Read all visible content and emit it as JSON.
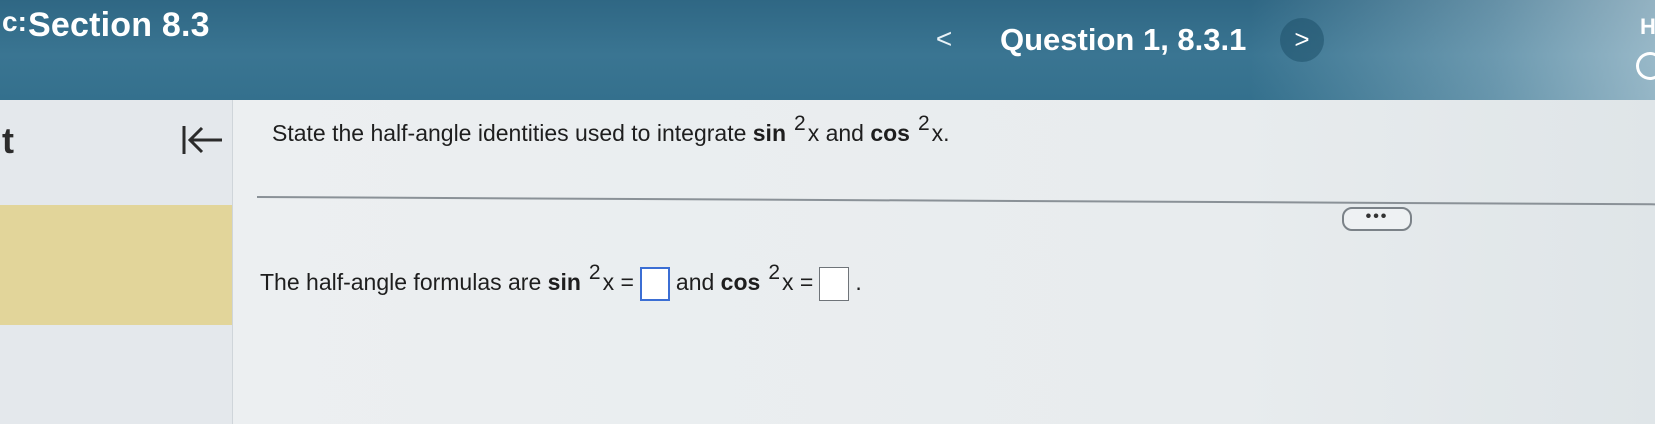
{
  "header": {
    "left_glyph": "c:",
    "section_title": "Section 8.3",
    "prev_label": "<",
    "question_title": "Question 1, 8.3.1",
    "next_label": ">",
    "right_letter": "H"
  },
  "sidebar": {
    "letter": "t"
  },
  "question": {
    "prompt": {
      "lead": "State the half-angle identities used to integrate ",
      "func1": "sin",
      "exp1": "2",
      "var1": "x and ",
      "func2": "cos",
      "exp2": "2",
      "var2": "x."
    },
    "more_label": "•••",
    "answer": {
      "lead": "The half-angle formulas are ",
      "func1": "sin",
      "exp1": "2",
      "var1": "x =",
      "middle": "and ",
      "func2": "cos",
      "exp2": "2",
      "var2": "x =",
      "end": "."
    }
  },
  "colors": {
    "header_bg": "#34708d",
    "highlight_band": "#e2d59a",
    "active_input_border": "#3b6ed4"
  },
  "icons": {
    "collapse": "collapse-left-arrow-icon",
    "more": "more-options-icon",
    "header_right": "help-icon"
  }
}
